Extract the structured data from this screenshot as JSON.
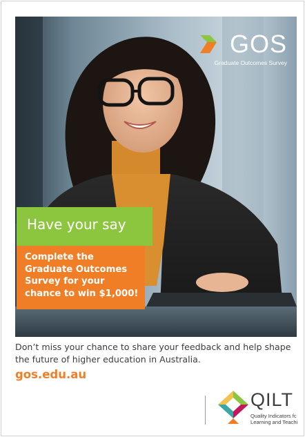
{
  "hero": {
    "logo": {
      "wordmark": "GOS",
      "subtitle": "Graduate Outcomes Survey",
      "colors": {
        "chevron_light": "#8cc63f",
        "chevron_dark": "#f07e26"
      }
    },
    "headline": "Have your say",
    "promo_lines": [
      "Complete the",
      "Graduate Outcomes",
      "Survey for your",
      "chance to win $1,000!"
    ]
  },
  "body_text": "Don’t miss your chance to share your feedback and help shape the future of higher education in Australia.",
  "website": "gos.edu.au",
  "footer_logo": {
    "wordmark": "QILT",
    "tagline_lines": [
      "Quality Indicators fc",
      "Learning and Teachi"
    ]
  },
  "colors": {
    "accent_orange": "#f07e26",
    "accent_green": "#8cc63f",
    "text_dark": "#3c3c3c"
  }
}
